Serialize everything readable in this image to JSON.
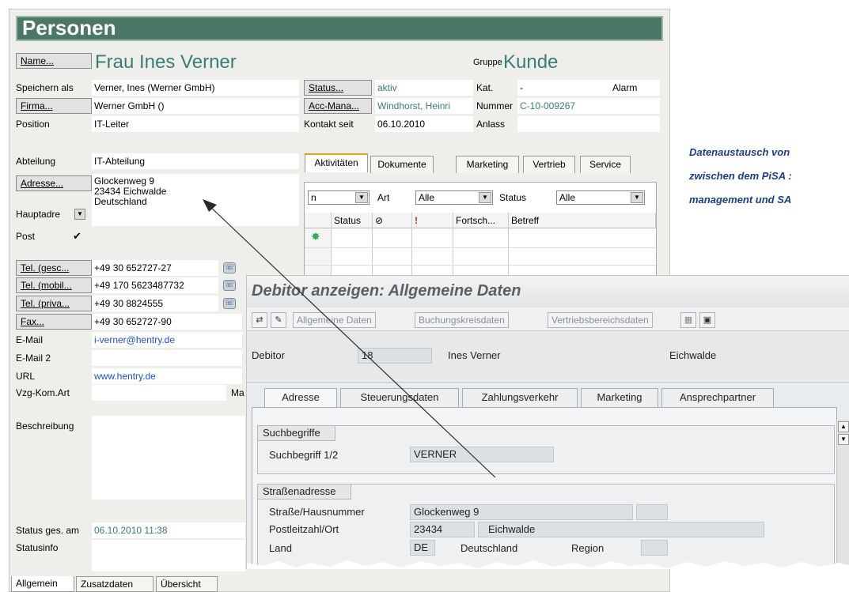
{
  "pisa": {
    "title": "Personen",
    "name_btn": "Name...",
    "name_value": "Frau Ines Verner",
    "gruppe_label": "Gruppe",
    "gruppe_value": "Kunde",
    "speichern_label": "Speichern als",
    "speichern_value": "Verner, Ines (Werner GmbH)",
    "status_btn": "Status...",
    "status_value": "aktiv",
    "kat_label": "Kat.",
    "kat_value": "-",
    "alarm_label": "Alarm",
    "firma_btn": "Firma...",
    "firma_value": "Werner GmbH ()",
    "acc_btn": "Acc-Mana...",
    "acc_value": "Windhorst, Heinri",
    "nummer_label": "Nummer",
    "nummer_value": "C-10-009267",
    "position_label": "Position",
    "position_value": "IT-Leiter",
    "kontakt_label": "Kontakt seit",
    "kontakt_value": "06.10.2010",
    "anlass_label": "Anlass",
    "abteilung_label": "Abteilung",
    "abteilung_value": "IT-Abteilung",
    "adresse_btn": "Adresse...",
    "adresse_line1": "Glockenweg 9",
    "adresse_line2": "23434 Eichwalde",
    "adresse_line3": "Deutschland",
    "hauptadre_label": "Hauptadre",
    "post_label": "Post",
    "post_check": "✔",
    "tabs": [
      "Aktivitäten",
      "Dokumente",
      "Marketing",
      "Vertrieb",
      "Service"
    ],
    "activity_filter": {
      "first_value": "n",
      "art_label": "Art",
      "art_value": "Alle",
      "status_label": "Status",
      "status_value": "Alle"
    },
    "activity_columns": [
      "Status",
      "",
      "!",
      "Fortsch...",
      "Betreff"
    ],
    "tel_rows": [
      {
        "btn": "Tel. (gesc...",
        "value": "+49 30 652727-27"
      },
      {
        "btn": "Tel. (mobil...",
        "value": "+49 170 5623487732"
      },
      {
        "btn": "Tel. (priva...",
        "value": "+49 30 8824555"
      },
      {
        "btn": "Fax...",
        "value": "+49 30 652727-90"
      }
    ],
    "email_label": "E-Mail",
    "email_value": "i-verner@hentry.de",
    "email2_label": "E-Mail 2",
    "url_label": "URL",
    "url_value": "www.hentry.de",
    "vzg_label": "Vzg-Kom.Art",
    "vzg_trail": "Ma",
    "beschreibung_label": "Beschreibung",
    "status_ges_label": "Status ges. am",
    "status_ges_value": "06.10.2010 11:38",
    "statusinfo_label": "Statusinfo",
    "bottom_tabs": [
      "Allgemein",
      "Zusatzdaten",
      "Übersicht"
    ]
  },
  "sap": {
    "title": "Debitor anzeigen: Allgemeine Daten",
    "toolbar": [
      "Allgemeine Daten",
      "Buchungskreisdaten",
      "Vertriebsbereichsdaten"
    ],
    "debitor_label": "Debitor",
    "debitor_value": "18",
    "debitor_name": "Ines Verner",
    "debitor_city": "Eichwalde",
    "tabs": [
      "Adresse",
      "Steuerungsdaten",
      "Zahlungsverkehr",
      "Marketing",
      "Ansprechpartner"
    ],
    "suchbegriffe_title": "Suchbegriffe",
    "suchbegriff_label": "Suchbegriff 1/2",
    "suchbegriff_value": "VERNER",
    "strasse_title": "Straßenadresse",
    "strasse_label": "Straße/Hausnummer",
    "strasse_value": "Glockenweg 9",
    "plz_label": "Postleitzahl/Ort",
    "plz_value": "23434",
    "ort_value": "Eichwalde",
    "land_label": "Land",
    "land_code": "DE",
    "land_name": "Deutschland",
    "region_label": "Region"
  },
  "annotation": {
    "line1": "Datenaustausch von",
    "line2": "zwischen dem PiSA :",
    "line3": "management und SA"
  },
  "colors": {
    "pisa_title_bg": "#4a7766",
    "teal_text": "#3a7c78",
    "link_blue": "#1f4fd0",
    "annotation_blue": "#1a3f86"
  }
}
